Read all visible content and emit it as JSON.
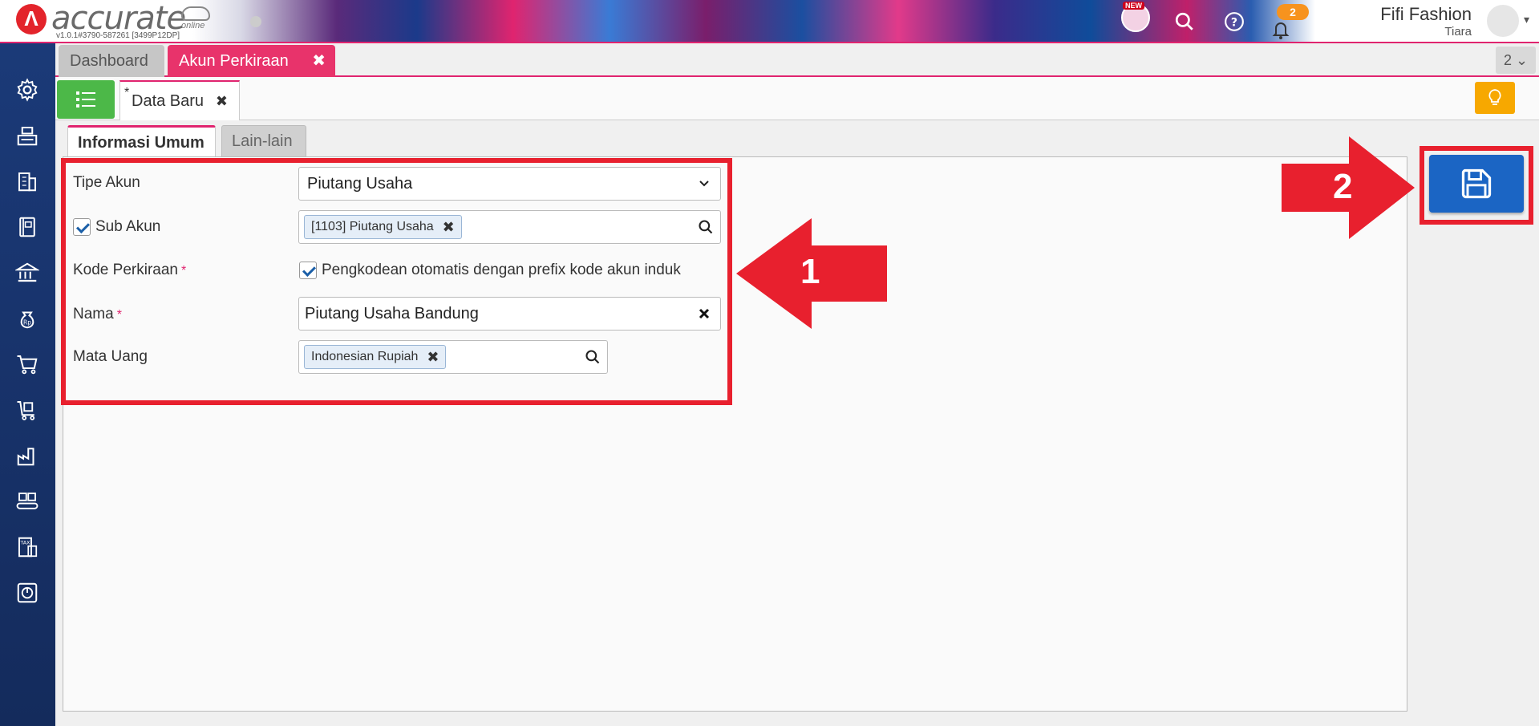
{
  "app": {
    "logo_text": "accurate",
    "logo_sub": "online",
    "version": "v1.0.1#3790-587261 [3499P12DP]",
    "new_label": "NEW",
    "notification_count": "2",
    "company": "Fifi Fashion",
    "user": "Tiara"
  },
  "tabs": {
    "dashboard": "Dashboard",
    "akun_perkiraan": "Akun Perkiraan",
    "count": "2"
  },
  "subtabs": {
    "data_baru_marker": "*",
    "data_baru": "Data Baru"
  },
  "form_tabs": {
    "informasi_umum": "Informasi Umum",
    "lain_lain": "Lain-lain"
  },
  "form": {
    "tipe_akun_label": "Tipe Akun",
    "tipe_akun_value": "Piutang Usaha",
    "sub_akun_label": "Sub Akun",
    "sub_akun_value": "[1103] Piutang Usaha",
    "kode_label": "Kode Perkiraan",
    "kode_auto_label": "Pengkodean otomatis dengan prefix kode akun induk",
    "nama_label": "Nama",
    "nama_value": "Piutang Usaha Bandung",
    "mata_uang_label": "Mata Uang",
    "mata_uang_value": "Indonesian Rupiah",
    "required_marker": "*"
  },
  "annotations": {
    "arrow1": "1",
    "arrow2": "2"
  },
  "colors": {
    "accent": "#e0246f",
    "highlight": "#e8202e",
    "save": "#1b65c4",
    "sidebar": "#1b3a78"
  }
}
